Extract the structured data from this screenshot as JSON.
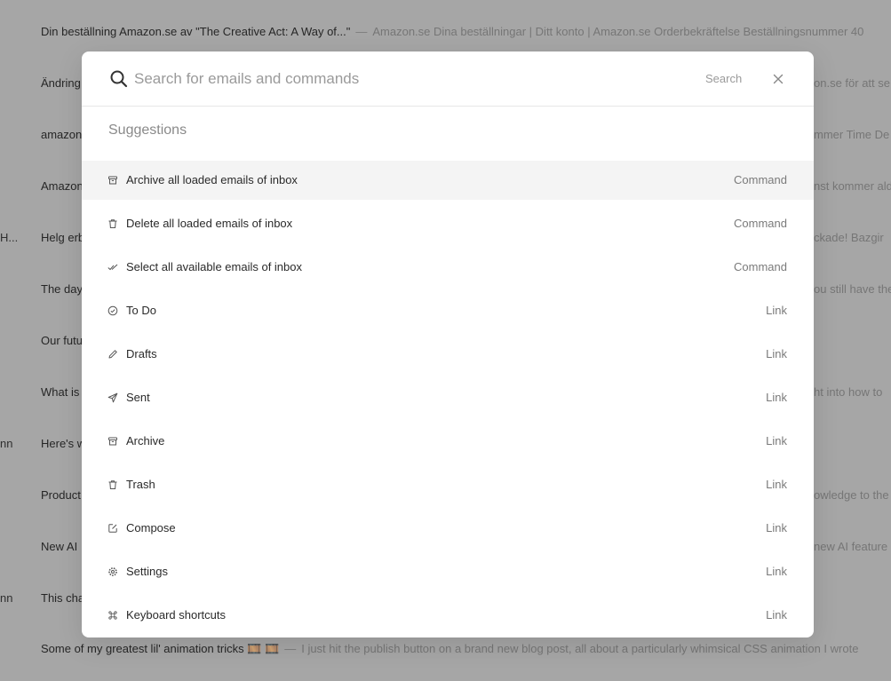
{
  "background": {
    "emails": [
      {
        "sender": "",
        "subject": "Din beställning Amazon.se av \"The Creative Act: A Way of...\"",
        "preview": "Amazon.se Dina beställningar | Ditt konto | Amazon.se Orderbekräftelse Beställningsnummer 40"
      },
      {
        "sender": "",
        "subject": "Ändring",
        "preview": "on.se för att se"
      },
      {
        "sender": "",
        "subject": "amazon",
        "preview": "mmer Time De"
      },
      {
        "sender": "",
        "subject": "Amazon",
        "preview": "nst kommer ald"
      },
      {
        "sender": "H...",
        "subject": "Helg erb",
        "preview": "ckade! Bazgir"
      },
      {
        "sender": "",
        "subject": "The day",
        "preview": "ou still have the"
      },
      {
        "sender": "",
        "subject": "Our futu",
        "preview": ""
      },
      {
        "sender": "",
        "subject": "What is",
        "preview": "ht into how to"
      },
      {
        "sender": "nn",
        "subject": "Here's w",
        "preview": ""
      },
      {
        "sender": "",
        "subject": "Product",
        "preview": "owledge to the"
      },
      {
        "sender": "",
        "subject": "New AI",
        "preview": "new AI feature"
      },
      {
        "sender": "nn",
        "subject": "This cha",
        "preview": ""
      },
      {
        "sender": "",
        "subject": "Some of my greatest lil' animation tricks 🎞️ 🎞️",
        "preview": "I just hit the publish button on a brand new blog post, all about a particularly whimsical CSS animation I wrote"
      }
    ]
  },
  "palette": {
    "search": {
      "placeholder": "Search for emails and commands",
      "value": "",
      "button_label": "Search"
    },
    "section_title": "Suggestions",
    "items": [
      {
        "label": "Archive all loaded emails of inbox",
        "kind": "Command",
        "icon": "archive-box-icon"
      },
      {
        "label": "Delete all loaded emails of inbox",
        "kind": "Command",
        "icon": "trash-icon"
      },
      {
        "label": "Select all available emails of inbox",
        "kind": "Command",
        "icon": "check-all-icon"
      },
      {
        "label": "To Do",
        "kind": "Link",
        "icon": "todo-circle-icon"
      },
      {
        "label": "Drafts",
        "kind": "Link",
        "icon": "pencil-icon"
      },
      {
        "label": "Sent",
        "kind": "Link",
        "icon": "send-icon"
      },
      {
        "label": "Archive",
        "kind": "Link",
        "icon": "archive-box-icon"
      },
      {
        "label": "Trash",
        "kind": "Link",
        "icon": "trash-icon"
      },
      {
        "label": "Compose",
        "kind": "Link",
        "icon": "compose-icon"
      },
      {
        "label": "Settings",
        "kind": "Link",
        "icon": "gear-icon"
      },
      {
        "label": "Keyboard shortcuts",
        "kind": "Link",
        "icon": "command-key-icon"
      }
    ]
  }
}
